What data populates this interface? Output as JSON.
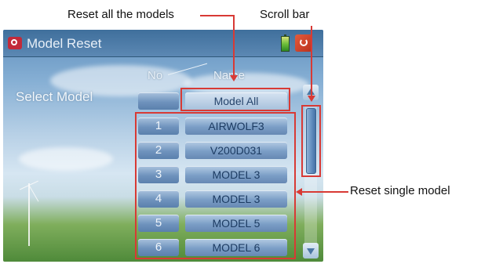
{
  "annotations": {
    "reset_all": "Reset all the models",
    "scroll_bar": "Scroll bar",
    "reset_single": "Reset single model"
  },
  "screen": {
    "title": "Model Reset",
    "select_label": "Select Model",
    "columns": {
      "no": "No",
      "name": "Name"
    },
    "all_row": {
      "no": "",
      "name": "Model All"
    },
    "rows": [
      {
        "no": "1",
        "name": "AIRWOLF3"
      },
      {
        "no": "2",
        "name": "V200D031"
      },
      {
        "no": "3",
        "name": "MODEL 3"
      },
      {
        "no": "4",
        "name": "MODEL 3"
      },
      {
        "no": "5",
        "name": "MODEL 5"
      },
      {
        "no": "6",
        "name": "MODEL 6"
      }
    ],
    "icons": {
      "title": "model-reset-icon",
      "battery": "battery-icon",
      "exit": "exit-icon",
      "scroll_up": "scroll-up-icon",
      "scroll_down": "scroll-down-icon"
    }
  },
  "colors": {
    "annotation": "#d83a35",
    "title_bar": "#4d7aa6"
  }
}
